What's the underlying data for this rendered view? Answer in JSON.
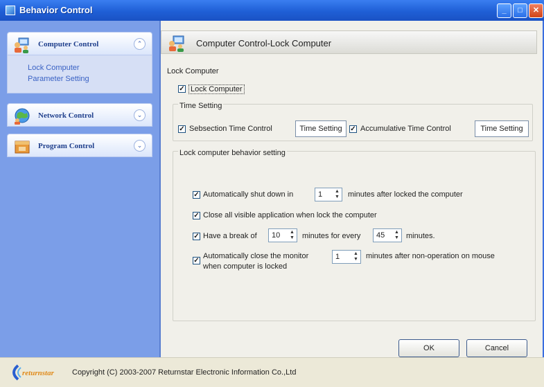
{
  "window": {
    "title": "Behavior Control",
    "buttons": {
      "minimize": "_",
      "maximize": "□",
      "close": "✕"
    }
  },
  "sidebar": {
    "panels": [
      {
        "label": "Computer Control",
        "chevron": "⌃",
        "expanded": true,
        "items": [
          "Lock Computer",
          "Parameter Setting"
        ]
      },
      {
        "label": "Network Control",
        "chevron": "⌄",
        "expanded": false
      },
      {
        "label": "Program Control",
        "chevron": "⌄",
        "expanded": false
      }
    ]
  },
  "main": {
    "header_title": "Computer Control-Lock Computer",
    "lock_section_label": "Lock Computer",
    "lock_computer": {
      "label": "Lock Computer",
      "checked": true
    },
    "time_setting": {
      "label": "Time Setting",
      "subsection": {
        "label": "Sebsection Time Control",
        "checked": true,
        "button": "Time Setting"
      },
      "accumulative": {
        "label": "Accumulative Time Control",
        "checked": true,
        "button": "Time Setting"
      }
    },
    "behavior": {
      "label": "Lock computer behavior setting",
      "shutdown": {
        "prefix": "Automatically shut down in",
        "value": "1",
        "suffix": "minutes after locked the computer",
        "checked": true
      },
      "close_apps": {
        "label": "Close all visible application when lock the computer",
        "checked": true
      },
      "break": {
        "prefix": "Have a break of",
        "value1": "10",
        "middle": "minutes for every",
        "value2": "45",
        "suffix": "minutes.",
        "checked": true
      },
      "monitor": {
        "prefix": "Automatically close the monitor",
        "value": "1",
        "suffix": "minutes after non-operation on mouse",
        "line2": "when computer is locked",
        "checked": true
      }
    },
    "ok_label": "OK",
    "cancel_label": "Cancel"
  },
  "footer": {
    "logo_text": "returnstar",
    "copyright": "Copyright (C) 2003-2007 Returnstar Electronic Information Co.,Ltd"
  },
  "colors": {
    "titlebar": "#1f5fd6",
    "sidebar_bg": "#7b9ee8",
    "panel_label": "#1f3f8c",
    "link": "#3a62c4",
    "content_bg": "#f1f0ea"
  },
  "icons": {
    "app": "window-app-icon",
    "computer_control": "computer-people-icon",
    "network_control": "globe-network-icon",
    "program_control": "program-box-icon",
    "header": "computer-people-icon",
    "logo": "returnstar-logo"
  }
}
